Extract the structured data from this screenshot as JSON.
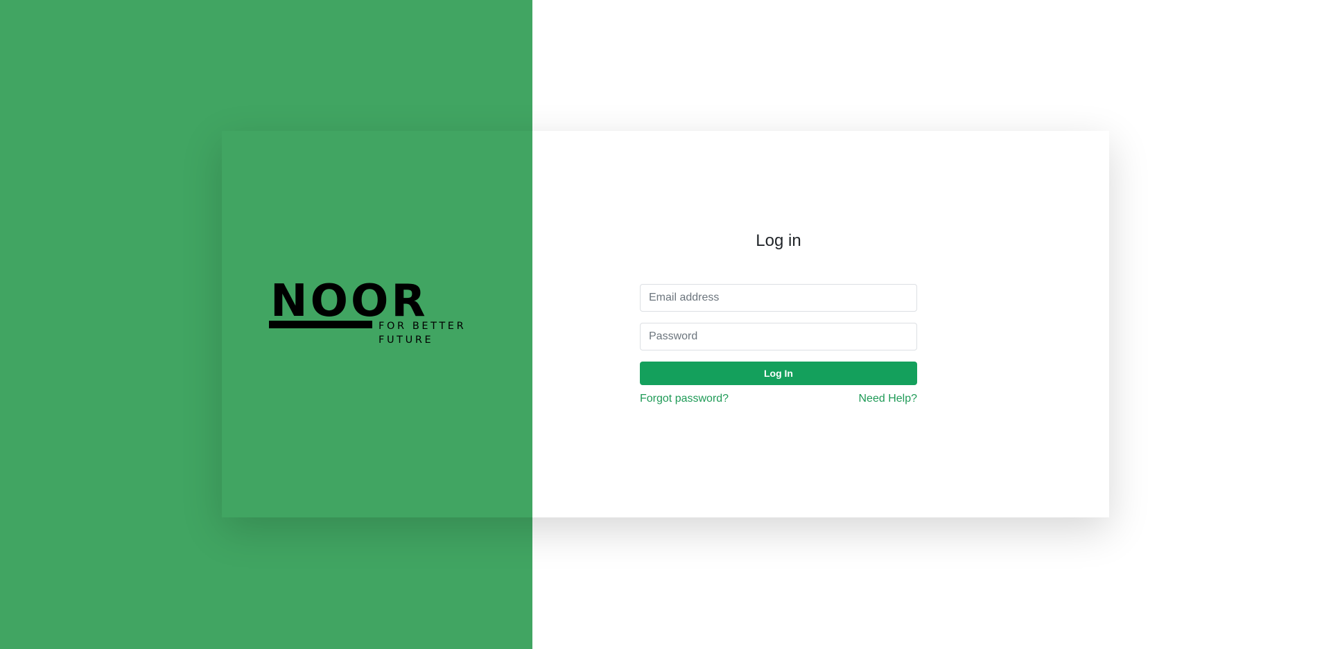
{
  "brand": {
    "logo_word": "NOOR",
    "tagline": "FOR BETTER FUTURE",
    "color_primary": "#41a562",
    "color_button": "#14a05c"
  },
  "login": {
    "title": "Log in",
    "email_placeholder": "Email address",
    "password_placeholder": "Password",
    "submit_label": "Log In",
    "forgot_password_label": "Forgot password?",
    "help_label": "Need Help?"
  }
}
